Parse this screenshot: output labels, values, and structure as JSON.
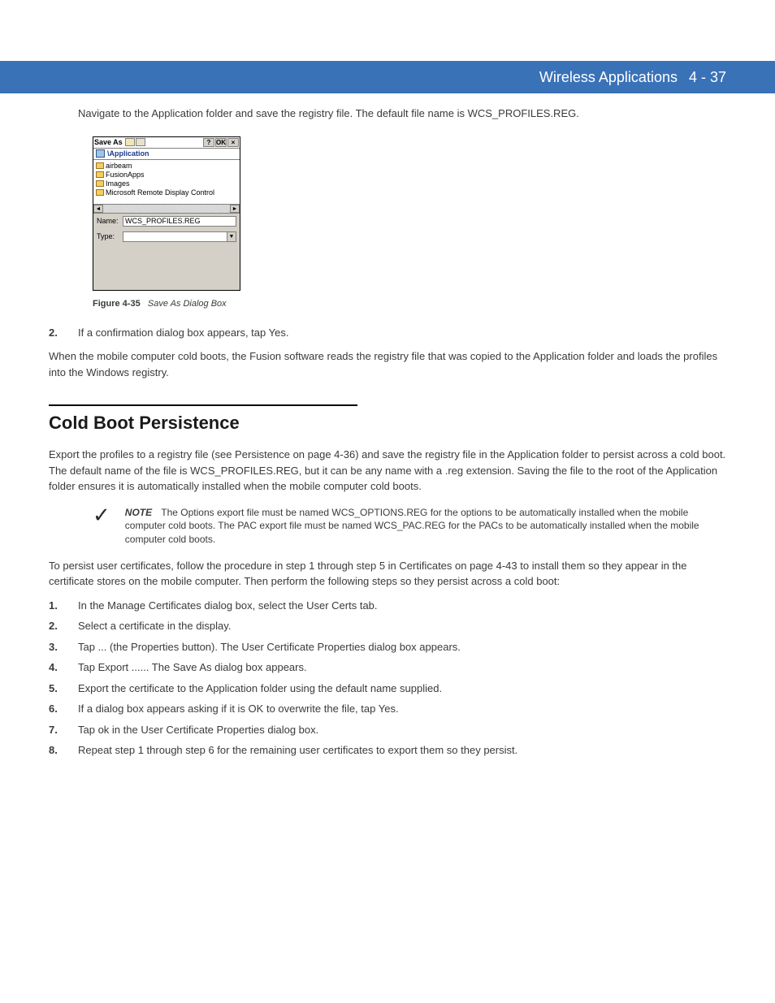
{
  "header": {
    "title": "Wireless Applications",
    "page": "4 - 37"
  },
  "intro1": "Navigate to the Application folder and save the registry file. The default file name is WCS_PROFILES.REG.",
  "dialog": {
    "title": "Save As",
    "path": "\\Application",
    "items": [
      "airbeam",
      "FusionApps",
      "Images",
      "Microsoft Remote Display Control"
    ],
    "nameLabel": "Name:",
    "nameValue": "WCS_PROFILES.REG",
    "typeLabel": "Type:"
  },
  "figure": {
    "label": "Figure 4-35",
    "caption": "Save As Dialog Box"
  },
  "step2Num": "2.",
  "step2Text": "If a confirmation dialog box appears, tap Yes.",
  "para_after": "When the mobile computer cold boots, the Fusion software reads the registry file that was copied to the Application folder and loads the profiles into the Windows registry.",
  "section": {
    "title": "Cold Boot Persistence"
  },
  "coldBootPara": "Export the profiles to a registry file (see Persistence on page 4-36) and save the registry file in the Application folder to persist across a cold boot. The default name of the file is WCS_PROFILES.REG, but it can be any name with a .reg extension. Saving the file to the root of the Application folder ensures it is automatically installed when the mobile computer cold boots.",
  "note": {
    "label": "NOTE",
    "text": "The Options export file must be named WCS_OPTIONS.REG for the options to be automatically installed when the mobile computer cold boots. The PAC export file must be named WCS_PAC.REG for the PACs to be automatically installed when the mobile computer cold boots."
  },
  "persistPara": "To persist user certificates, follow the procedure in step 1 through step 5 in Certificates on page 4-43 to install them so they appear in the certificate stores on the mobile computer. Then perform the following steps so they persist across a cold boot:",
  "persistSteps": [
    {
      "num": "1.",
      "text": "In the Manage Certificates dialog box, select the User Certs tab."
    },
    {
      "num": "2.",
      "text": "Select a certificate in the display."
    },
    {
      "num": "3.",
      "text": "Tap ... (the Properties button). The User Certificate Properties dialog box appears."
    },
    {
      "num": "4.",
      "text": "Tap Export ...... The Save As dialog box appears."
    },
    {
      "num": "5.",
      "text": "Export the certificate to the Application folder using the default name supplied."
    },
    {
      "num": "6.",
      "text": "If a dialog box appears asking if it is OK to overwrite the file, tap Yes."
    },
    {
      "num": "7.",
      "text": "Tap ok in the User Certificate Properties dialog box."
    },
    {
      "num": "8.",
      "text": "Repeat step 1 through step 6 for the remaining user certificates to export them so they persist."
    }
  ]
}
